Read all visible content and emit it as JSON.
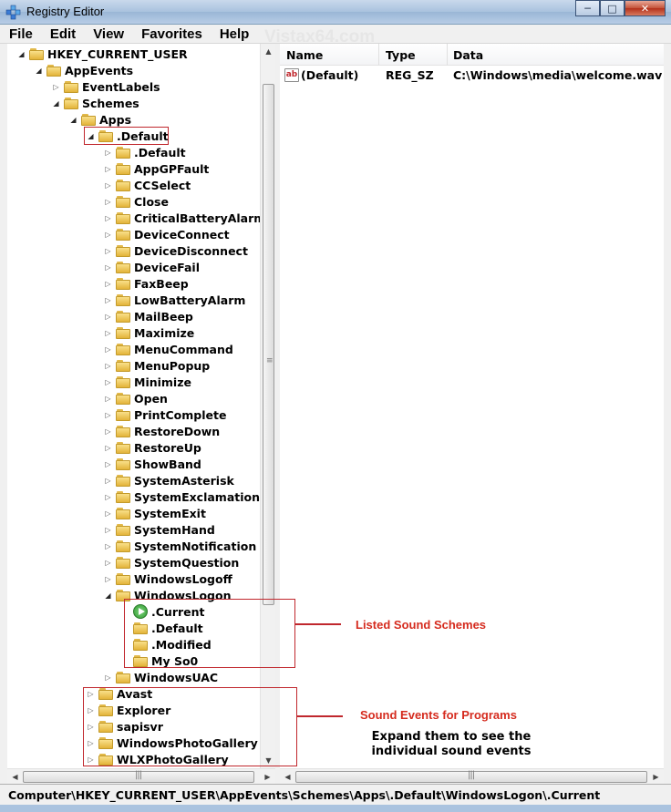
{
  "window": {
    "title": "Registry Editor",
    "watermark": "Vistax64.com"
  },
  "menu": [
    "File",
    "Edit",
    "View",
    "Favorites",
    "Help"
  ],
  "tree": [
    {
      "label": "HKEY_CURRENT_USER",
      "level": 0,
      "expander": "open"
    },
    {
      "label": "AppEvents",
      "level": 1,
      "expander": "open"
    },
    {
      "label": "EventLabels",
      "level": 2,
      "expander": "closed"
    },
    {
      "label": "Schemes",
      "level": 2,
      "expander": "open"
    },
    {
      "label": "Apps",
      "level": 3,
      "expander": "open"
    },
    {
      "label": ".Default",
      "level": 4,
      "expander": "open"
    },
    {
      "label": ".Default",
      "level": 5,
      "expander": "closed"
    },
    {
      "label": "AppGPFault",
      "level": 5,
      "expander": "closed"
    },
    {
      "label": "CCSelect",
      "level": 5,
      "expander": "closed"
    },
    {
      "label": "Close",
      "level": 5,
      "expander": "closed"
    },
    {
      "label": "CriticalBatteryAlarm",
      "level": 5,
      "expander": "closed"
    },
    {
      "label": "DeviceConnect",
      "level": 5,
      "expander": "closed"
    },
    {
      "label": "DeviceDisconnect",
      "level": 5,
      "expander": "closed"
    },
    {
      "label": "DeviceFail",
      "level": 5,
      "expander": "closed"
    },
    {
      "label": "FaxBeep",
      "level": 5,
      "expander": "closed"
    },
    {
      "label": "LowBatteryAlarm",
      "level": 5,
      "expander": "closed"
    },
    {
      "label": "MailBeep",
      "level": 5,
      "expander": "closed"
    },
    {
      "label": "Maximize",
      "level": 5,
      "expander": "closed"
    },
    {
      "label": "MenuCommand",
      "level": 5,
      "expander": "closed"
    },
    {
      "label": "MenuPopup",
      "level": 5,
      "expander": "closed"
    },
    {
      "label": "Minimize",
      "level": 5,
      "expander": "closed"
    },
    {
      "label": "Open",
      "level": 5,
      "expander": "closed"
    },
    {
      "label": "PrintComplete",
      "level": 5,
      "expander": "closed"
    },
    {
      "label": "RestoreDown",
      "level": 5,
      "expander": "closed"
    },
    {
      "label": "RestoreUp",
      "level": 5,
      "expander": "closed"
    },
    {
      "label": "ShowBand",
      "level": 5,
      "expander": "closed"
    },
    {
      "label": "SystemAsterisk",
      "level": 5,
      "expander": "closed"
    },
    {
      "label": "SystemExclamation",
      "level": 5,
      "expander": "closed"
    },
    {
      "label": "SystemExit",
      "level": 5,
      "expander": "closed"
    },
    {
      "label": "SystemHand",
      "level": 5,
      "expander": "closed"
    },
    {
      "label": "SystemNotification",
      "level": 5,
      "expander": "closed"
    },
    {
      "label": "SystemQuestion",
      "level": 5,
      "expander": "closed"
    },
    {
      "label": "WindowsLogoff",
      "level": 5,
      "expander": "closed"
    },
    {
      "label": "WindowsLogon",
      "level": 5,
      "expander": "open"
    },
    {
      "label": ".Current",
      "level": 6,
      "expander": "none",
      "icon": "sound-icon",
      "selected": true
    },
    {
      "label": ".Default",
      "level": 6,
      "expander": "none"
    },
    {
      "label": ".Modified",
      "level": 6,
      "expander": "none"
    },
    {
      "label": "My So0",
      "level": 6,
      "expander": "none"
    },
    {
      "label": "WindowsUAC",
      "level": 5,
      "expander": "closed"
    },
    {
      "label": "Avast",
      "level": 4,
      "expander": "closed"
    },
    {
      "label": "Explorer",
      "level": 4,
      "expander": "closed"
    },
    {
      "label": "sapisvr",
      "level": 4,
      "expander": "closed"
    },
    {
      "label": "WindowsPhotoGallery",
      "level": 4,
      "expander": "closed"
    },
    {
      "label": "WLXPhotoGallery",
      "level": 4,
      "expander": "closed"
    }
  ],
  "list": {
    "columns": [
      "Name",
      "Type",
      "Data"
    ],
    "rows": [
      {
        "name": "(Default)",
        "type": "REG_SZ",
        "data": "C:\\Windows\\media\\welcome.wav",
        "icon": "ab-icon"
      }
    ]
  },
  "status_path": "Computer\\HKEY_CURRENT_USER\\AppEvents\\Schemes\\Apps\\.Default\\WindowsLogon\\.Current",
  "annotations": {
    "listed": "Listed Sound Schemes",
    "programs": "Sound Events for Programs",
    "note_line1": "Expand them to see the",
    "note_line2": "individual sound events",
    "color": "#c0272d"
  }
}
